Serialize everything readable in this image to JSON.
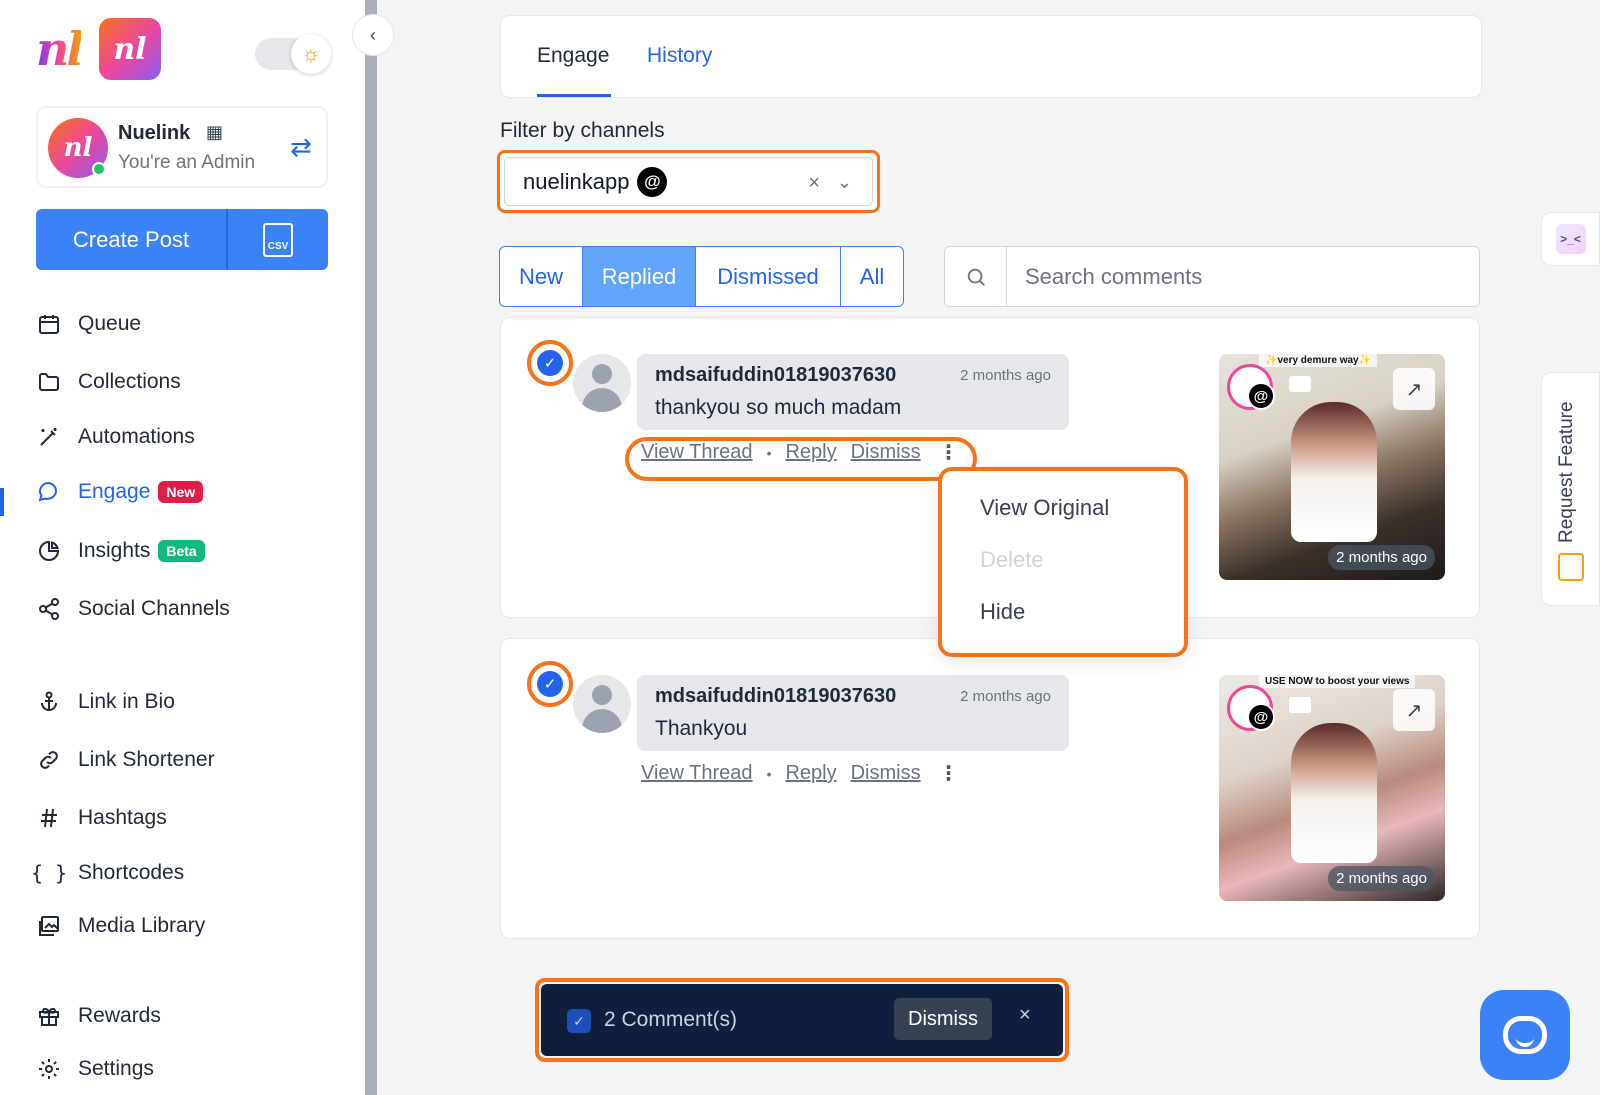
{
  "sidebar": {
    "account": {
      "name": "Nuelink",
      "role": "You're an Admin"
    },
    "create_post_label": "Create Post",
    "csv_label": "CSV",
    "nav": [
      {
        "label": "Queue",
        "icon": "calendar-icon"
      },
      {
        "label": "Collections",
        "icon": "folder-icon"
      },
      {
        "label": "Automations",
        "icon": "magic-wand-icon"
      },
      {
        "label": "Engage",
        "icon": "chat-bubble-icon",
        "badge": "New",
        "active": true
      },
      {
        "label": "Insights",
        "icon": "pie-chart-icon",
        "badge": "Beta"
      },
      {
        "label": "Social Channels",
        "icon": "share-icon"
      },
      {
        "label": "Link in Bio",
        "icon": "anchor-icon"
      },
      {
        "label": "Link Shortener",
        "icon": "link-icon"
      },
      {
        "label": "Hashtags",
        "icon": "hash-icon"
      },
      {
        "label": "Shortcodes",
        "icon": "braces-icon"
      },
      {
        "label": "Media Library",
        "icon": "images-icon"
      },
      {
        "label": "Rewards",
        "icon": "gift-icon"
      },
      {
        "label": "Settings",
        "icon": "gear-icon"
      }
    ]
  },
  "tabs": {
    "engage": "Engage",
    "history": "History"
  },
  "filter": {
    "label": "Filter by channels",
    "value": "nuelinkapp"
  },
  "segments": [
    "New",
    "Replied",
    "Dismissed",
    "All"
  ],
  "search": {
    "placeholder": "Search comments"
  },
  "comments": [
    {
      "user": "mdsaifuddin01819037630",
      "time": "2 months ago",
      "message": "thankyou so much madam",
      "post_time": "2 months ago",
      "overlay": "✨very demure way✨"
    },
    {
      "user": "mdsaifuddin01819037630",
      "time": "2 months ago",
      "message": "Thankyou",
      "post_time": "2 months ago",
      "overlay": "USE NOW to boost your views"
    }
  ],
  "actions": {
    "view_thread": "View Thread",
    "reply": "Reply",
    "dismiss": "Dismiss"
  },
  "menu": {
    "view_original": "View Original",
    "delete": "Delete",
    "hide": "Hide"
  },
  "bulk": {
    "count": "2 Comment(s)",
    "dismiss": "Dismiss"
  },
  "request_feature": "Request Feature",
  "colors": {
    "accent": "#2563eb",
    "highlight": "#f97316",
    "bulk_bg": "#0f1f3d"
  }
}
